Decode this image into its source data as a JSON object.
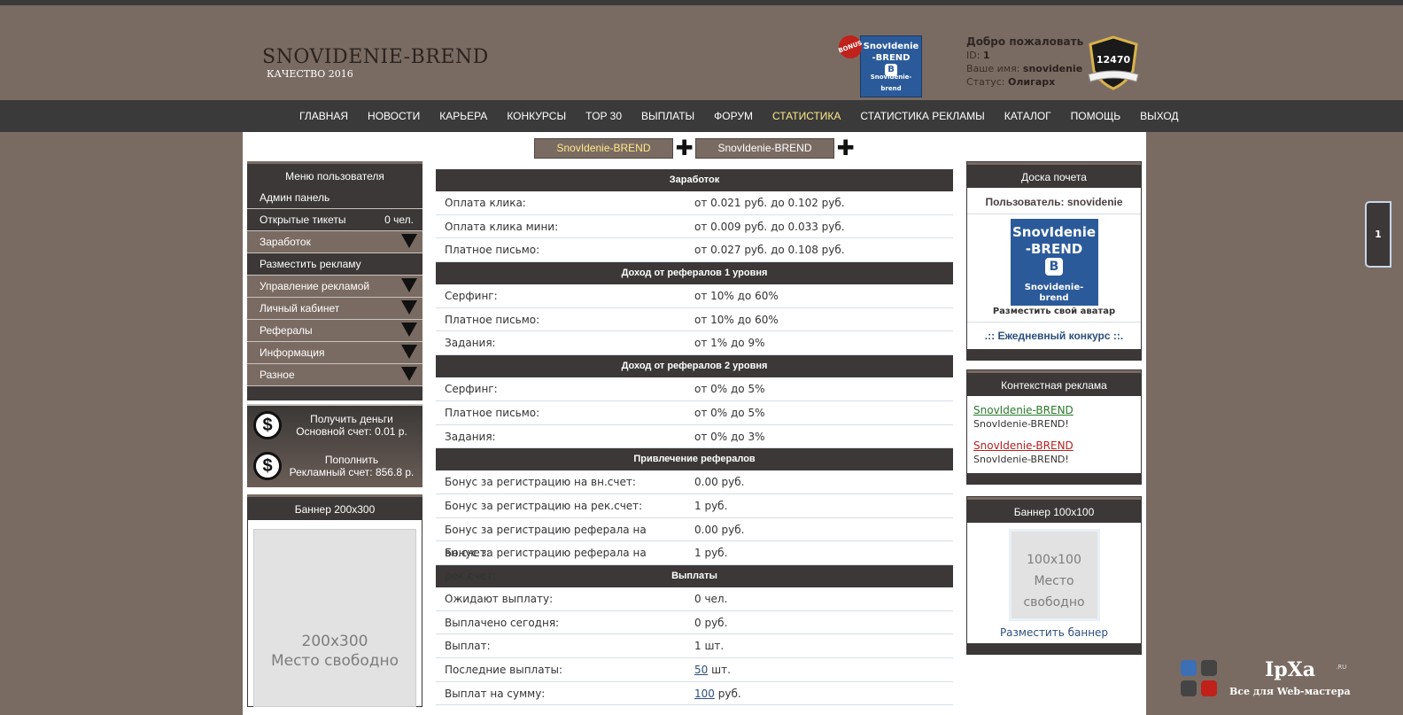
{
  "header": {
    "logo_title": "SNOVIDENIE-BREND",
    "logo_subtitle": "КАЧЕСТВО 2016",
    "bonus_badge": "BONUS",
    "avatar_small": {
      "line1": "SnovIdenie",
      "line2": "-BREND",
      "vk": "B",
      "caption": "Snovidenie-brend"
    },
    "welcome": {
      "title": "Добро пожаловать",
      "id_label": "ID:",
      "id_value": "1",
      "name_label": "Ваше имя:",
      "name_value": "snovidenie",
      "status_label": "Статус:",
      "status_value": "Олигарх"
    },
    "shield_number": "12470"
  },
  "nav": {
    "items": [
      "ГЛАВНАЯ",
      "НОВОСТИ",
      "КАРЬЕРА",
      "КОНКУРСЫ",
      "TOP 30",
      "ВЫПЛАТЫ",
      "ФОРУМ",
      "СТАТИСТИКА",
      "СТАТИСТИКА РЕКЛАМЫ",
      "КАТАЛОГ",
      "ПОМОЩЬ",
      "ВЫХОД"
    ],
    "active_index": 7
  },
  "tabs": {
    "tab1": "SnovIdenie-BREND",
    "tab2": "SnovIdenie-BREND",
    "plus": "✚"
  },
  "user_menu": {
    "title": "Меню пользователя",
    "items": [
      {
        "label": "Админ панель"
      },
      {
        "label": "Открытые тикеты",
        "count": "0 чел."
      },
      {
        "label": "Заработок"
      },
      {
        "label": "Разместить рекламу"
      },
      {
        "label": "Управление рекламой"
      },
      {
        "label": "Личный кабинет"
      },
      {
        "label": "Рефералы"
      },
      {
        "label": "Информация"
      },
      {
        "label": "Разное"
      }
    ]
  },
  "money": {
    "get_title": "Получить деньги",
    "get_balance": "Основной счет: 0.01 р.",
    "topup_title": "Пополнить",
    "topup_balance": "Рекламный счет: 856.8 р.",
    "coin": "$"
  },
  "banner_left": {
    "title": "Баннер 200x300",
    "size": "200x300",
    "text": "Место свободно"
  },
  "stats": {
    "sections": [
      {
        "title": "Заработок",
        "rows": [
          {
            "k": "Оплата клика:",
            "v": "от 0.021 руб. до 0.102 руб."
          },
          {
            "k": "Оплата клика мини:",
            "v": "от 0.009 руб. до 0.033 руб."
          },
          {
            "k": "Платное письмо:",
            "v": "от 0.027 руб. до 0.108 руб."
          }
        ]
      },
      {
        "title": "Доход от рефералов 1 уровня",
        "rows": [
          {
            "k": "Серфинг:",
            "v": "от 10% до 60%"
          },
          {
            "k": "Платное письмо:",
            "v": "от 10% до 60%"
          },
          {
            "k": "Задания:",
            "v": "от 1% до 9%"
          }
        ]
      },
      {
        "title": "Доход от рефералов 2 уровня",
        "rows": [
          {
            "k": "Серфинг:",
            "v": "от 0% до 5%"
          },
          {
            "k": "Платное письмо:",
            "v": "от 0% до 5%"
          },
          {
            "k": "Задания:",
            "v": "от 0% до 3%"
          }
        ]
      },
      {
        "title": "Привлечение рефералов",
        "rows": [
          {
            "k": "Бонус за регистрацию на вн.счет:",
            "v": "0.00 руб."
          },
          {
            "k": "Бонус за регистрацию на рек.счет:",
            "v": "1 руб."
          },
          {
            "k": "Бонус за регистрацию реферала на вн.счет:",
            "v": "0.00 руб."
          },
          {
            "k": "Бонус за регистрацию реферала на рек.счет:",
            "v": "1 руб."
          }
        ]
      },
      {
        "title": "Выплаты",
        "rows": [
          {
            "k": "Ожидают выплату:",
            "v": "0 чел."
          },
          {
            "k": "Выплачено сегодня:",
            "v": "0 руб."
          },
          {
            "k": "Выплат:",
            "v": "1 шт."
          },
          {
            "k": "Последние выплаты:",
            "v_link": "50",
            "v_rest": " шт."
          },
          {
            "k": "Выплат на сумму:",
            "v_link": "100",
            "v_rest": " руб."
          }
        ]
      }
    ]
  },
  "honor_board": {
    "title": "Доска почета",
    "user_line": "Пользователь: snovidenie",
    "avatar": {
      "line1": "SnovIdenie",
      "line2": "-BREND",
      "vk": "B",
      "caption": "Snovidenie-brend"
    },
    "avatar_link": "Разместить свой аватар",
    "daily_contest": ".:: Ежедневный конкурс ::."
  },
  "context_ads": {
    "title": "Контекстная реклама",
    "ads": [
      {
        "link": "SnovIdenie-BREND",
        "desc": "SnovIdenie-BREND!"
      },
      {
        "link": "SnovIdenie-BREND",
        "desc": "SnovIdenie-BREND!"
      }
    ]
  },
  "banner_right": {
    "title": "Баннер 100x100",
    "size": "100x100",
    "line1": "Место",
    "line2": "свободно",
    "link": "Разместить баннер"
  },
  "side_tab": "1",
  "watermark": {
    "brand": "IpXa",
    "tld": ".RU",
    "tagline": "Все для Web-мастера"
  }
}
